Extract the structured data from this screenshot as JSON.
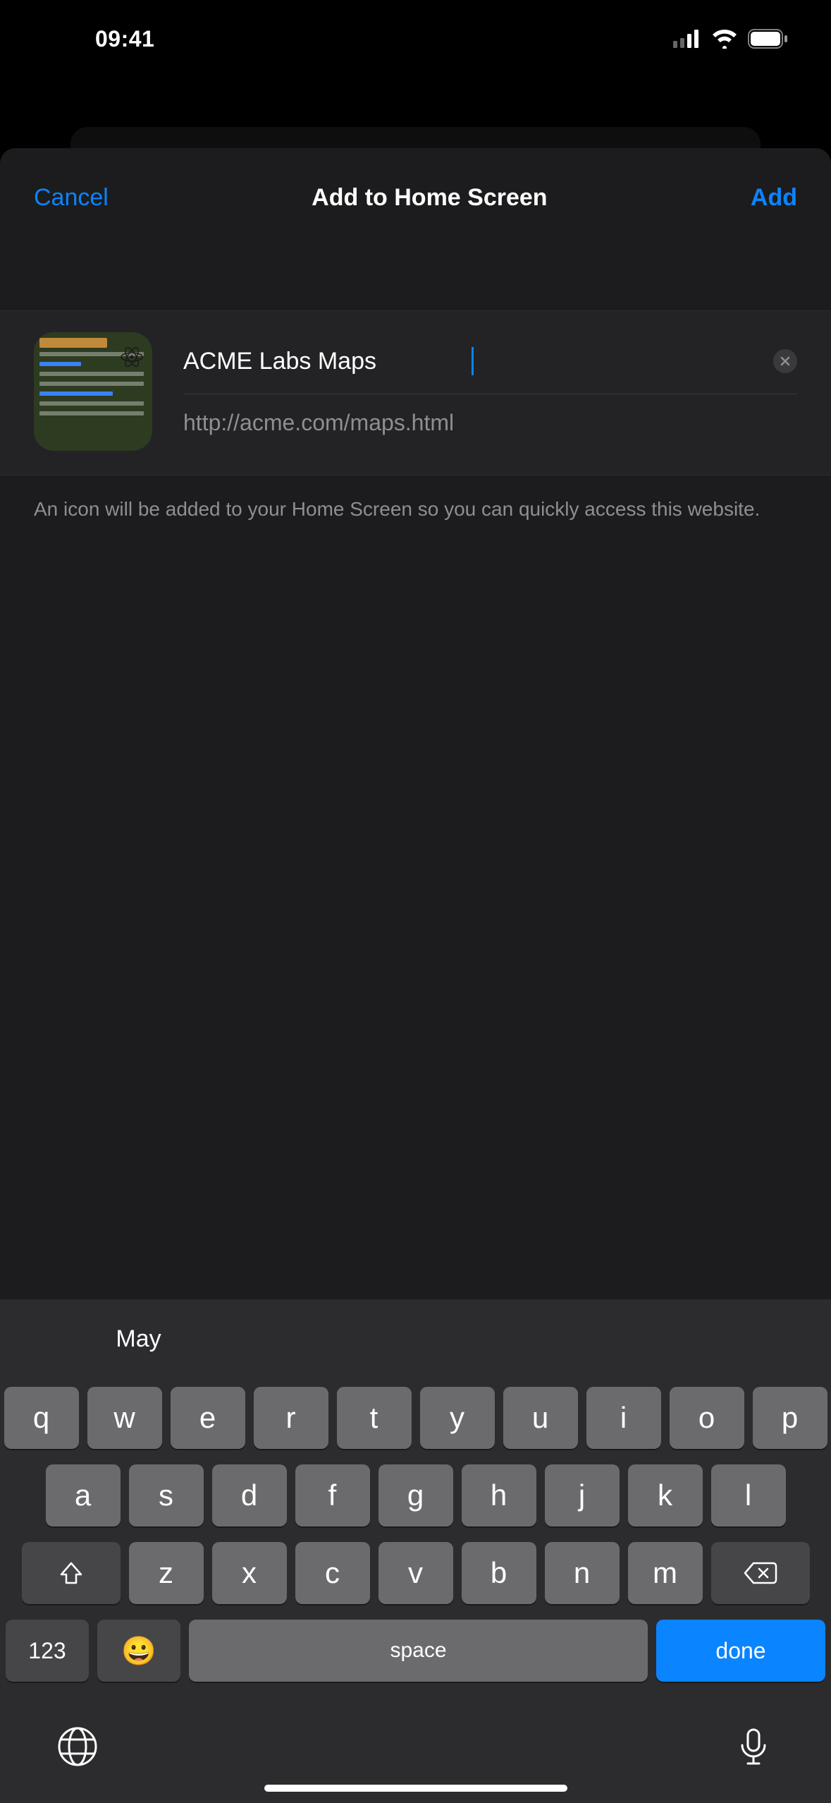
{
  "status": {
    "time": "09:41"
  },
  "nav": {
    "cancel": "Cancel",
    "title": "Add to Home Screen",
    "add": "Add"
  },
  "form": {
    "title_value": "ACME Labs Maps",
    "url": "http://acme.com/maps.html",
    "hint": "An icon will be added to your Home Screen so you can quickly access this website."
  },
  "keyboard": {
    "suggestions": [
      "May",
      "",
      ""
    ],
    "rows": [
      [
        "q",
        "w",
        "e",
        "r",
        "t",
        "y",
        "u",
        "i",
        "o",
        "p"
      ],
      [
        "a",
        "s",
        "d",
        "f",
        "g",
        "h",
        "j",
        "k",
        "l"
      ],
      [
        "z",
        "x",
        "c",
        "v",
        "b",
        "n",
        "m"
      ]
    ],
    "num_key": "123",
    "space": "space",
    "done": "done"
  }
}
